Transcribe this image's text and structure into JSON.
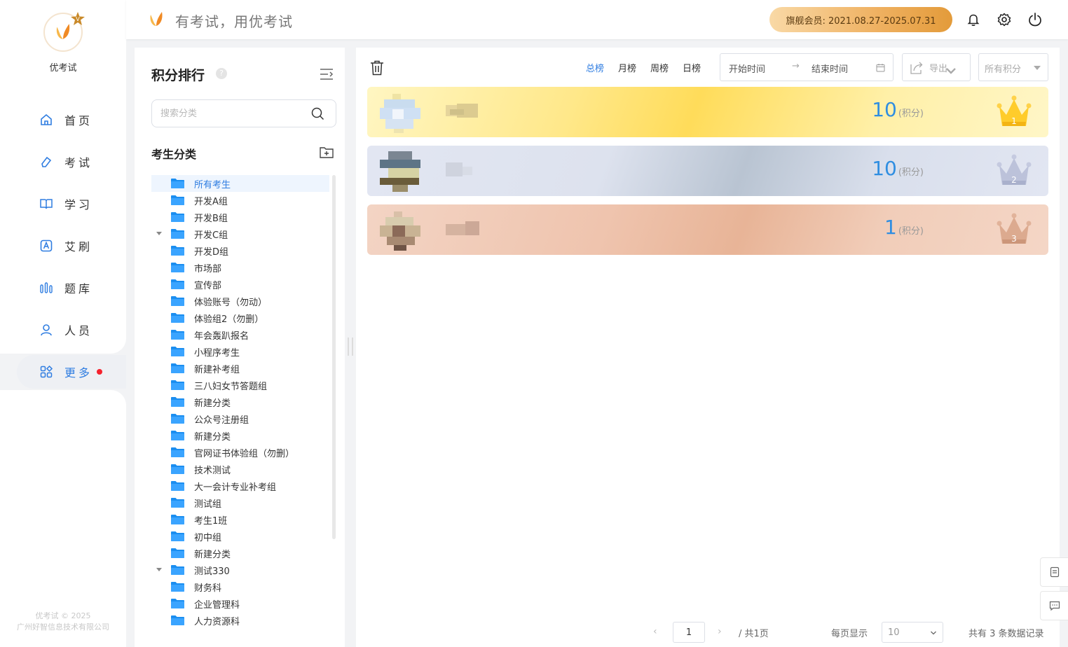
{
  "app": {
    "name": "优考试",
    "slogan": "有考试，用优考试",
    "copyright_line1": "优考试 © 2025",
    "copyright_line2": "广州好智信息技术有限公司"
  },
  "header": {
    "vip_label": "旗舰会员: 2021.08.27-2025.07.31"
  },
  "nav": {
    "items": [
      {
        "label": "首页",
        "icon": "home-icon"
      },
      {
        "label": "考试",
        "icon": "eraser-icon"
      },
      {
        "label": "学习",
        "icon": "book-icon"
      },
      {
        "label": "艾刷",
        "icon": "a-icon"
      },
      {
        "label": "题库",
        "icon": "bars-icon"
      },
      {
        "label": "人员",
        "icon": "user-icon"
      },
      {
        "label": "更多",
        "icon": "apps-icon"
      }
    ]
  },
  "category_panel": {
    "title": "积分排行",
    "help": "?",
    "search_placeholder": "搜索分类",
    "section_title": "考生分类",
    "tree": [
      {
        "label": "所有考生",
        "active": true,
        "caret": false
      },
      {
        "label": "开发A组",
        "caret": false
      },
      {
        "label": "开发B组",
        "caret": false
      },
      {
        "label": "开发C组",
        "caret": true
      },
      {
        "label": "开发D组",
        "caret": false
      },
      {
        "label": "市场部",
        "caret": false
      },
      {
        "label": "宣传部",
        "caret": false
      },
      {
        "label": "体验账号（勿动）",
        "caret": false
      },
      {
        "label": "体验组2（勿删）",
        "caret": false
      },
      {
        "label": "年会轰趴报名",
        "caret": false
      },
      {
        "label": "小程序考生",
        "caret": false
      },
      {
        "label": "新建补考组",
        "caret": false
      },
      {
        "label": "三八妇女节答题组",
        "caret": false
      },
      {
        "label": "新建分类",
        "caret": false
      },
      {
        "label": "公众号注册组",
        "caret": false
      },
      {
        "label": "新建分类",
        "caret": false
      },
      {
        "label": "官网证书体验组（勿删）",
        "caret": false
      },
      {
        "label": "技术测试",
        "caret": false
      },
      {
        "label": "大一会计专业补考组",
        "caret": false
      },
      {
        "label": "测试组",
        "caret": false
      },
      {
        "label": "考生1班",
        "caret": false
      },
      {
        "label": "初中组",
        "caret": false
      },
      {
        "label": "新建分类",
        "caret": false
      },
      {
        "label": "测试330",
        "caret": true
      },
      {
        "label": "财务科",
        "caret": false
      },
      {
        "label": "企业管理科",
        "caret": false
      },
      {
        "label": "人力资源科",
        "caret": false
      }
    ]
  },
  "toolbar": {
    "tabs": [
      "总榜",
      "月榜",
      "周榜",
      "日榜"
    ],
    "active_tab": 0,
    "start_placeholder": "开始时间",
    "range_arrow": "→",
    "end_placeholder": "结束时间",
    "export_label": "导出",
    "points_filter": "所有积分"
  },
  "ranking": [
    {
      "rank": "1",
      "score": "10",
      "unit": "(积分)"
    },
    {
      "rank": "2",
      "score": "10",
      "unit": "(积分)"
    },
    {
      "rank": "3",
      "score": "1",
      "unit": "(积分)"
    }
  ],
  "pagination": {
    "prev": "‹",
    "current_page": "1",
    "next": "›",
    "total_pages": "/ 共1页",
    "per_page_label": "每页显示",
    "per_page": "10",
    "total_records": "共有 3 条数据记录"
  },
  "colors": {
    "accent": "#2f7de1",
    "score": "#2f8ee1",
    "gold": "#ffd040",
    "silver": "#b8bfdb",
    "bronze": "#d9a78c"
  }
}
